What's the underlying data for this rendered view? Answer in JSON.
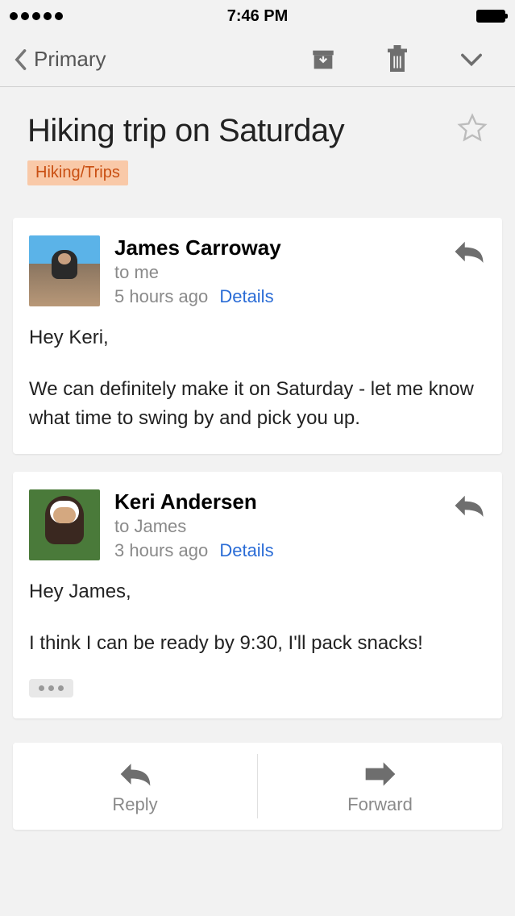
{
  "status": {
    "time": "7:46 PM"
  },
  "nav": {
    "back_label": "Primary"
  },
  "subject": {
    "title": "Hiking trip on Saturday",
    "label": "Hiking/Trips"
  },
  "messages": [
    {
      "sender": "James Carroway",
      "recipient": "to me",
      "time": "5 hours ago",
      "details_label": "Details",
      "body_greeting": "Hey Keri,",
      "body_text": "We can definitely make it on Saturday - let me know what time to swing by and pick you up."
    },
    {
      "sender": "Keri Andersen",
      "recipient": "to James",
      "time": "3 hours ago",
      "details_label": "Details",
      "body_greeting": "Hey James,",
      "body_text": "I think I can be ready by 9:30, I'll pack snacks!"
    }
  ],
  "actions": {
    "reply_label": "Reply",
    "forward_label": "Forward"
  }
}
